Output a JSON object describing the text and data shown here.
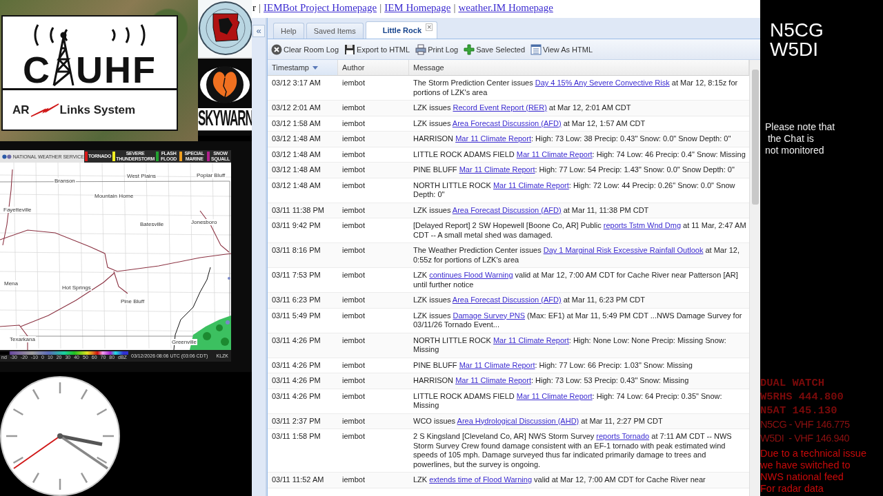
{
  "logo": {
    "wordmark_left": "C",
    "wordmark_right": "UHF",
    "tagline_left": "AR",
    "tagline_right": "Links System"
  },
  "skywarn": {
    "label": "SKYWARN"
  },
  "radar": {
    "agency": "NATIONAL WEATHER SERVICE",
    "legend": [
      {
        "label": "TORNADO",
        "color": "#d81818"
      },
      {
        "label": "SEVERE THUNDERSTORM",
        "color": "#f2ee22"
      },
      {
        "label": "FLASH FLOOD",
        "color": "#22a030"
      },
      {
        "label": "SPECIAL MARINE",
        "color": "#f0a020"
      },
      {
        "label": "SNOW SQUALL",
        "color": "#b0208c"
      }
    ],
    "cities": [
      "Branson",
      "West Plains",
      "Poplar Bluff",
      "Mountain Home",
      "Fayetteville",
      "Batesville",
      "Jonesboro",
      "Mena",
      "Hot Springs",
      "Pine Bluff",
      "Texarkana",
      "Greenville"
    ],
    "scale": [
      "nd",
      "-30",
      "-20",
      "-10",
      "0",
      "10",
      "20",
      "30",
      "40",
      "50",
      "60",
      "70",
      "80",
      "dBZ"
    ],
    "timestamp": "03/12/2026 08:06 UTC (03:06 CDT)",
    "station": "KLZK"
  },
  "chat": {
    "cut_text": "r",
    "separator": "|",
    "links": [
      "IEMBot Project Homepage",
      "IEM Homepage",
      "weather.IM Homepage"
    ],
    "collapse_glyph": "«",
    "tabs": [
      {
        "label": "Help",
        "selected": false,
        "closable": false
      },
      {
        "label": "Saved Items",
        "selected": false,
        "closable": false
      },
      {
        "label": "Little Rock",
        "selected": true,
        "closable": true,
        "close_glyph": "×"
      }
    ],
    "toolbar": [
      {
        "kind": "clear",
        "label": "Clear Room Log"
      },
      {
        "kind": "export",
        "label": "Export to HTML"
      },
      {
        "kind": "print",
        "label": "Print Log"
      },
      {
        "kind": "save",
        "label": "Save Selected"
      },
      {
        "kind": "view",
        "label": "View As HTML"
      }
    ],
    "columns": [
      {
        "label": "Timestamp",
        "sorted": true
      },
      {
        "label": "Author",
        "sorted": false
      },
      {
        "label": "Message",
        "sorted": false
      }
    ],
    "rows": [
      {
        "time": "03/12 3:17 AM",
        "author": "iembot",
        "pre": "The Storm Prediction Center issues",
        "link": "Day 4 15% Any Severe Convective Risk",
        "post": "at Mar 12, 8:15z for portions of LZK's area"
      },
      {
        "time": "03/12 2:01 AM",
        "author": "iembot",
        "pre": "LZK issues",
        "link": "Record Event Report (RER)",
        "post": "at Mar 12, 2:01 AM CDT"
      },
      {
        "time": "03/12 1:58 AM",
        "author": "iembot",
        "pre": "LZK issues",
        "link": "Area Forecast Discussion (AFD)",
        "post": "at Mar 12, 1:57 AM CDT"
      },
      {
        "time": "03/12 1:48 AM",
        "author": "iembot",
        "pre": "HARRISON",
        "link": "Mar 11 Climate Report",
        "post": ": High: 73 Low: 38 Precip: 0.43\" Snow: 0.0\" Snow Depth: 0\""
      },
      {
        "time": "03/12 1:48 AM",
        "author": "iembot",
        "pre": "LITTLE ROCK ADAMS FIELD",
        "link": "Mar 11 Climate Report",
        "post": ": High: 74 Low: 46 Precip: 0.4\" Snow: Missing"
      },
      {
        "time": "03/12 1:48 AM",
        "author": "iembot",
        "pre": "PINE BLUFF",
        "link": "Mar 11 Climate Report",
        "post": ": High: 77 Low: 54 Precip: 1.43\" Snow: 0.0\" Snow Depth: 0\""
      },
      {
        "time": "03/12 1:48 AM",
        "author": "iembot",
        "pre": "NORTH LITTLE ROCK",
        "link": "Mar 11 Climate Report",
        "post": ": High: 72 Low: 44 Precip: 0.26\" Snow: 0.0\" Snow Depth: 0\""
      },
      {
        "time": "03/11 11:38 PM",
        "author": "iembot",
        "pre": "LZK issues",
        "link": "Area Forecast Discussion (AFD)",
        "post": "at Mar 11, 11:38 PM CDT"
      },
      {
        "time": "03/11 9:42 PM",
        "author": "iembot",
        "pre": "[Delayed Report] 2 SW Hopewell [Boone Co, AR] Public",
        "link": "reports Tstm Wnd Dmg",
        "post": "at 11 Mar, 2:47 AM CDT -- A small metal shed was damaged."
      },
      {
        "time": "03/11 8:16 PM",
        "author": "iembot",
        "pre": "The Weather Prediction Center issues",
        "link": "Day 1 Marginal Risk Excessive Rainfall Outlook",
        "post": "at Mar 12, 0:55z for portions of LZK's area"
      },
      {
        "time": "03/11 7:53 PM",
        "author": "iembot",
        "pre": "LZK",
        "link": "continues Flood Warning",
        "post": "valid at Mar 12, 7:00 AM CDT for Cache River near Patterson [AR] until further notice"
      },
      {
        "time": "03/11 6:23 PM",
        "author": "iembot",
        "pre": "LZK issues",
        "link": "Area Forecast Discussion (AFD)",
        "post": "at Mar 11, 6:23 PM CDT"
      },
      {
        "time": "03/11 5:49 PM",
        "author": "iembot",
        "pre": "LZK issues",
        "link": "Damage Survey PNS",
        "post": "(Max: EF1) at Mar 11, 5:49 PM CDT ...NWS Damage Survey for 03/11/26 Tornado Event..."
      },
      {
        "time": "03/11 4:26 PM",
        "author": "iembot",
        "pre": "NORTH LITTLE ROCK",
        "link": "Mar 11 Climate Report",
        "post": ": High: None Low: None Precip: Missing Snow: Missing"
      },
      {
        "time": "03/11 4:26 PM",
        "author": "iembot",
        "pre": "PINE BLUFF",
        "link": "Mar 11 Climate Report",
        "post": ": High: 77 Low: 66 Precip: 1.03\" Snow: Missing"
      },
      {
        "time": "03/11 4:26 PM",
        "author": "iembot",
        "pre": "HARRISON",
        "link": "Mar 11 Climate Report",
        "post": ": High: 73 Low: 53 Precip: 0.43\" Snow: Missing"
      },
      {
        "time": "03/11 4:26 PM",
        "author": "iembot",
        "pre": "LITTLE ROCK ADAMS FIELD",
        "link": "Mar 11 Climate Report",
        "post": ": High: 74 Low: 64 Precip: 0.35\" Snow: Missing"
      },
      {
        "time": "03/11 2:37 PM",
        "author": "iembot",
        "pre": "WCO issues",
        "link": "Area Hydrological Discussion (AHD)",
        "post": "at Mar 11, 2:27 PM CDT"
      },
      {
        "time": "03/11 1:58 PM",
        "author": "iembot",
        "pre": "2 S Kingsland [Cleveland Co, AR] NWS Storm Survey",
        "link": "reports Tornado",
        "post": "at 7:11 AM CDT -- NWS Storm Survey Crew found damage consistent with an EF-1 tornado with peak estimated wind speeds of 105 mph. Damage surveyed thus far indicated primarily damage to trees and powerlines, but the survey is ongoing."
      },
      {
        "time": "03/11 11:52 AM",
        "author": "iembot",
        "pre": "LZK",
        "link": "extends time of Flood Warning",
        "post": "valid at Mar 12, 7:00 AM CDT for Cache River near"
      }
    ]
  },
  "side": {
    "callsigns": [
      "N5CG",
      "W5DI"
    ],
    "note": [
      "Please note that",
      " the Chat is",
      "not monitored"
    ],
    "lines": [
      {
        "kind": "mono",
        "text": "DUAL WATCH"
      },
      {
        "kind": "mono",
        "text": "W5RHS 444.800"
      },
      {
        "kind": "mono",
        "text": "N5AT 145.130"
      },
      {
        "kind": "sans",
        "text": "N5CG - VHF 146.775"
      },
      {
        "kind": "sans",
        "text": "W5DI  - VHF 146.940"
      },
      {
        "kind": "notice",
        "text": "Due to a technical issue"
      },
      {
        "kind": "notice",
        "text": "we have switched to"
      },
      {
        "kind": "notice",
        "text": "NWS national feed"
      },
      {
        "kind": "notice",
        "text": "For radar data"
      }
    ]
  }
}
